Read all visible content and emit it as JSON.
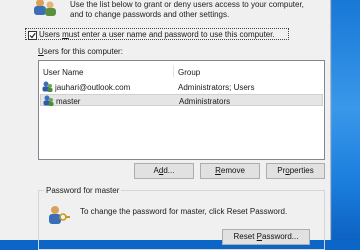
{
  "intro": {
    "line1": "Use the list below to grant or deny users access to your computer,",
    "line2": "and to change passwords and other settings."
  },
  "checkbox": {
    "label_before": "Users ",
    "label_accel": "m",
    "label_after": "ust enter a user name and password to use this computer.",
    "checked": true
  },
  "users_label": {
    "accel": "U",
    "rest": "sers for this computer:"
  },
  "table": {
    "columns": [
      "User Name",
      "Group"
    ],
    "rows": [
      {
        "name": "jauhari@outlook.com",
        "group": "Administrators; Users",
        "selected": false
      },
      {
        "name": "master",
        "group": "Administrators",
        "selected": true
      }
    ]
  },
  "buttons": {
    "add_before": "A",
    "add_accel": "d",
    "add_after": "d...",
    "remove_accel": "R",
    "remove_after": "emove",
    "properties_before": "Pr",
    "properties_accel": "o",
    "properties_after": "perties"
  },
  "password": {
    "title": "Password for master",
    "text": "To change the password for master, click Reset Password.",
    "reset_before": "Reset ",
    "reset_accel": "P",
    "reset_after": "assword..."
  },
  "colors": {
    "desktop": "#0c66c8",
    "window": "#f0f0f0",
    "selection": "#e5e5e5"
  }
}
